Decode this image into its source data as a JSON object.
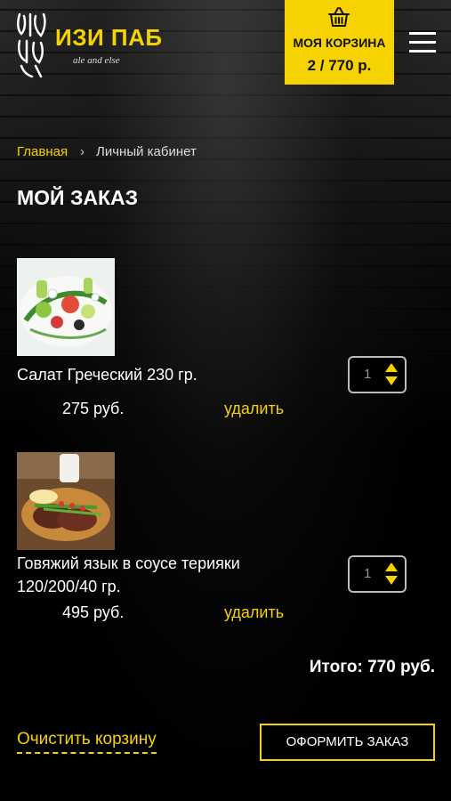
{
  "header": {
    "logo_title": "ИЗИ ПАБ",
    "logo_subtitle": "ale and else",
    "cart_label": "МОЯ КОРЗИНА",
    "cart_total": "2 / 770 р."
  },
  "breadcrumb": {
    "home": "Главная",
    "separator": "›",
    "current": "Личный кабинет"
  },
  "page_title": "МОЙ ЗАКАЗ",
  "items": [
    {
      "name": "Салат Греческий 230 гр.",
      "price": "275 руб.",
      "delete_label": "удалить",
      "quantity": "1"
    },
    {
      "name": "Говяжий язык в соусе терияки 120/200/40 гр.",
      "price": "495 руб.",
      "delete_label": "удалить",
      "quantity": "1"
    }
  ],
  "total": "Итого: 770 руб.",
  "clear_cart": "Очистить корзину",
  "checkout": "ОФОРМИТЬ ЗАКАЗ",
  "colors": {
    "accent": "#f5d200",
    "background": "#000000",
    "text": "#ffffff"
  }
}
